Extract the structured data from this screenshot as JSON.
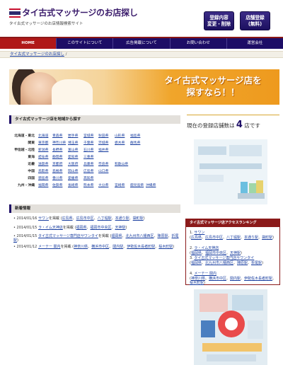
{
  "header": {
    "title": "タイ古式マッサージのお店探し",
    "subtitle": "タイ古式マッサージのお店情報検索サイト",
    "btn_register_change": "登録内容\n変更・削除",
    "btn_shop_register": "店舗登録\n(無料)"
  },
  "nav": [
    "HOME",
    "このサイトについて",
    "広告掲載について",
    "お問い合わせ",
    "運営会社"
  ],
  "breadcrumb": {
    "link": "タイ古式マッサージのお店探し",
    "sep": "/"
  },
  "banner": {
    "line1": "タイ古式マッサージ店を",
    "line2": "探すなら！！"
  },
  "region_section": {
    "title": "タイ古式マッサージ店を地域から探す",
    "rows": [
      {
        "name": "北海道・東北",
        "prefs": [
          "北海道",
          "青森県",
          "岩手県",
          "宮城県",
          "秋田県",
          "山形県",
          "福島県"
        ]
      },
      {
        "name": "関東",
        "prefs": [
          "東京都",
          "神奈川県",
          "埼玉県",
          "千葉県",
          "茨城県",
          "栃木県",
          "群馬県"
        ]
      },
      {
        "name": "甲信越・北陸",
        "prefs": [
          "新潟県",
          "長野県",
          "富山県",
          "石川県",
          "福井県"
        ]
      },
      {
        "name": "東海",
        "prefs": [
          "岐阜県",
          "静岡県",
          "愛知県",
          "三重県"
        ]
      },
      {
        "name": "近畿",
        "prefs": [
          "滋賀県",
          "京都府",
          "大阪府",
          "兵庫県",
          "奈良県",
          "和歌山県"
        ]
      },
      {
        "name": "中国",
        "prefs": [
          "鳥取県",
          "島根県",
          "岡山県",
          "広島県",
          "山口県"
        ]
      },
      {
        "name": "四国",
        "prefs": [
          "徳島県",
          "香川県",
          "愛媛県",
          "高知県"
        ]
      },
      {
        "name": "九州・沖縄",
        "prefs": [
          "福岡県",
          "佐賀県",
          "長崎県",
          "熊本県",
          "大分県",
          "宮崎県",
          "鹿児島県",
          "沖縄県"
        ]
      }
    ]
  },
  "news_section": {
    "title": "新着情報",
    "items": [
      {
        "date": "2014/01/16",
        "shop": "サワン",
        "text": "を掲載",
        "areas": [
          "広島県",
          "広島市中区",
          "八丁堀駅",
          "本通り駅",
          "袋町駅"
        ]
      },
      {
        "date": "2014/01/15",
        "shop": "ラ・イム天神店",
        "text": "を掲載",
        "areas": [
          "福岡県",
          "福岡市中央区",
          "天神駅"
        ]
      },
      {
        "date": "2014/01/15",
        "shop": "タイ古式マッサージ専門店サワンタイ",
        "text": "を掲載",
        "areas": [
          "福岡県",
          "北九州市八幡西区",
          "陣原駅",
          "折尾駅"
        ]
      },
      {
        "date": "2014/01/12",
        "shop": "メーテー 関内",
        "text": "を掲載",
        "areas": [
          "神奈川県",
          "横浜市中区",
          "関内駅",
          "伊勢佐木長者町駅",
          "桜木町駅"
        ]
      }
    ]
  },
  "store_count": {
    "prefix": "現在の登録店舗数は",
    "number": "4",
    "suffix": "店です"
  },
  "ranking": {
    "title": "タイ古式マッサージ店アクセスランキング",
    "items": [
      {
        "rank": "1.",
        "shop": "サワン",
        "areas": [
          "広島県",
          "広島市中区",
          "八丁堀駅",
          "本通り駅",
          "袋町駅"
        ]
      },
      {
        "rank": "2.",
        "shop": "ラ・イム天神店",
        "areas": [
          "福岡県",
          "福岡市中央区",
          "天神駅"
        ]
      },
      {
        "rank": "3.",
        "shop": "タイ古式マッサージ専門店サワンタイ",
        "areas": [
          "福岡県",
          "北九州市八幡西区",
          "陣原駅",
          "折尾駅"
        ]
      },
      {
        "rank": "4.",
        "shop": "メーテー 関内",
        "areas": [
          "神奈川県",
          "横浜市中区",
          "関内駅",
          "伊勢佐木長者町駅",
          "桜木町駅"
        ]
      }
    ]
  },
  "colors": {
    "navy": "#1d0d66",
    "red": "#b01818",
    "accent": "#f0a52b"
  }
}
